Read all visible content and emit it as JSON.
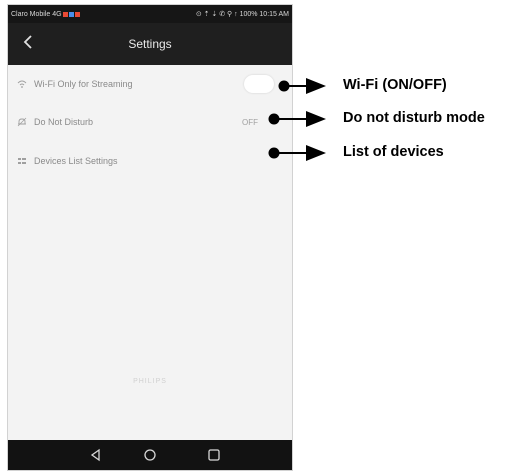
{
  "status_bar": {
    "carrier": "Claro Mobile 4G",
    "right_text": "⊙ ⇡ ⇣ ✆ ⚲ ↑ 100%  10:15 AM",
    "icon_colors": [
      "#e94a35",
      "#4a8fe9",
      "#e94a35"
    ]
  },
  "app_bar": {
    "title": "Settings",
    "back_icon": "chevron-left-icon"
  },
  "settings": {
    "items": [
      {
        "label": "Wi-Fi Only for Streaming",
        "icon": "wifi-icon",
        "value": "",
        "toggle_on": false
      },
      {
        "label": "Do Not Disturb",
        "icon": "bell-icon",
        "value": "OFF"
      },
      {
        "label": "Devices List Settings",
        "icon": "list-icon",
        "value": ""
      }
    ]
  },
  "footer": {
    "text": "PHILIPS"
  },
  "nav_bar": {
    "buttons": [
      "back-triangle-icon",
      "home-circle-icon",
      "recents-square-icon"
    ]
  },
  "annotations": [
    {
      "text": "Wi-Fi (ON/OFF)"
    },
    {
      "text": "Do not disturb mode"
    },
    {
      "text": "List of devices"
    }
  ]
}
